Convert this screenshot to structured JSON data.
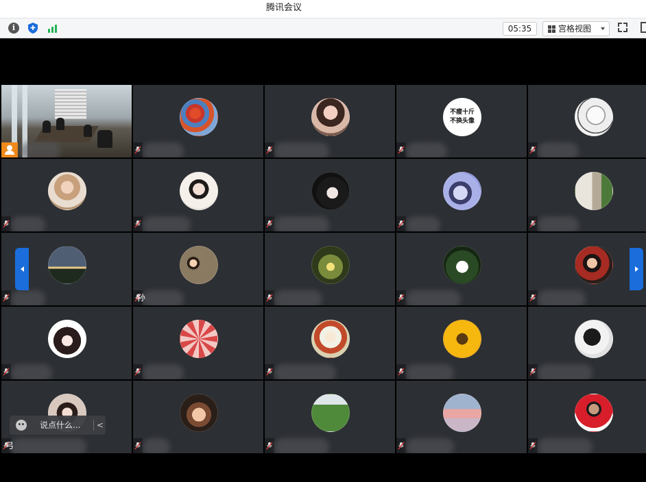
{
  "window": {
    "title": "腾讯会议"
  },
  "toolbar": {
    "timer": "05:35",
    "view_mode": "宫格视图",
    "icons": [
      "info-icon",
      "shield-icon",
      "signal-icon",
      "grid-icon",
      "fullscreen-icon"
    ]
  },
  "chat": {
    "placeholder": "说点什么...",
    "collapse": "<"
  },
  "participants": [
    {
      "name": "",
      "avatar": "room-camera"
    },
    {
      "name": "",
      "avatar": "autumn-leaves"
    },
    {
      "name": "",
      "avatar": "girl-portrait"
    },
    {
      "name": "",
      "avatar": "text-avatar",
      "avatar_text_1": "不瘦十斤",
      "avatar_text_2": "不换头像"
    },
    {
      "name": "",
      "avatar": "sketch-portrait"
    },
    {
      "name": "",
      "avatar": "girl-blonde"
    },
    {
      "name": "",
      "avatar": "girl-hood"
    },
    {
      "name": "",
      "avatar": "girl-dark"
    },
    {
      "name": "",
      "avatar": "cartoon-unicorn"
    },
    {
      "name": "",
      "avatar": "person-outdoor"
    },
    {
      "name": "",
      "avatar": "night-house"
    },
    {
      "name": "孙",
      "avatar": "cartoon-couple"
    },
    {
      "name": "",
      "avatar": "glowing-field"
    },
    {
      "name": "",
      "avatar": "bride-garden"
    },
    {
      "name": "",
      "avatar": "boy-red"
    },
    {
      "name": "",
      "avatar": "anime-girl"
    },
    {
      "name": "",
      "avatar": "red-flower"
    },
    {
      "name": "",
      "avatar": "anime-boy"
    },
    {
      "name": "",
      "avatar": "sunflower"
    },
    {
      "name": "",
      "avatar": "bw-silhouette"
    },
    {
      "name": "弓",
      "avatar": "girl-hat"
    },
    {
      "name": "",
      "avatar": "baby-photo"
    },
    {
      "name": "",
      "avatar": "lotus-field"
    },
    {
      "name": "",
      "avatar": "pink-sky"
    },
    {
      "name": "",
      "avatar": "athlete-red"
    }
  ],
  "colors": {
    "tile": "#2c2f33",
    "accent": "#1a6ddb",
    "host": "#f08a1a",
    "muted_mic": "#e23a3a"
  }
}
